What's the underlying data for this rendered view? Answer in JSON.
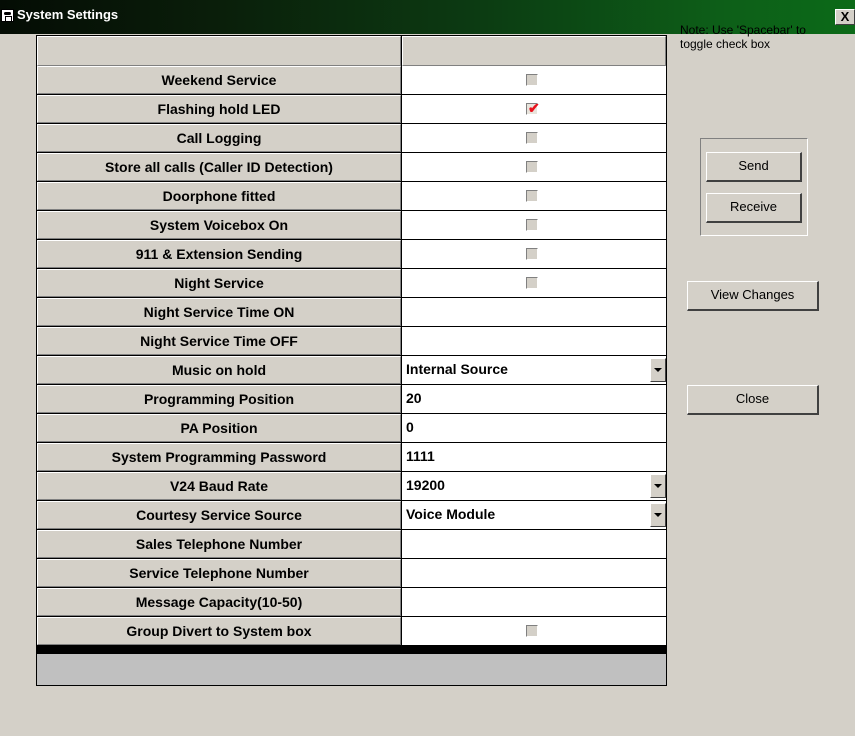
{
  "window": {
    "title": "System Settings",
    "close_glyph": "X"
  },
  "note": "Note: Use 'Spacebar' to toggle check box",
  "buttons": {
    "send": "Send",
    "receive": "Receive",
    "view_changes": "View Changes",
    "close": "Close"
  },
  "colors": {
    "check_mark": "#e8111c",
    "panel": "#d4d0c8",
    "title_start": "#040c04",
    "title_end": "#0c6a18"
  },
  "icons": {
    "app": "phone-icon",
    "check": "check-mark-icon",
    "dropdown": "chevron-down-icon"
  },
  "settings": [
    {
      "label": "Weekend Service",
      "type": "checkbox",
      "checked": false
    },
    {
      "label": "Flashing hold LED",
      "type": "checkbox",
      "checked": true
    },
    {
      "label": "Call Logging",
      "type": "checkbox",
      "checked": false
    },
    {
      "label": "Store all calls (Caller ID Detection)",
      "type": "checkbox",
      "checked": false
    },
    {
      "label": "Doorphone fitted",
      "type": "checkbox",
      "checked": false
    },
    {
      "label": "System Voicebox On",
      "type": "checkbox",
      "checked": false
    },
    {
      "label": "911 & Extension Sending",
      "type": "checkbox",
      "checked": false
    },
    {
      "label": "Night Service",
      "type": "checkbox",
      "checked": false
    },
    {
      "label": "Night Service Time ON",
      "type": "text",
      "value": ""
    },
    {
      "label": "Night Service Time OFF",
      "type": "text",
      "value": ""
    },
    {
      "label": "Music on hold",
      "type": "dropdown",
      "value": "Internal Source"
    },
    {
      "label": "Programming Position",
      "type": "text",
      "value": "20"
    },
    {
      "label": "PA Position",
      "type": "text",
      "value": "0"
    },
    {
      "label": "System Programming Password",
      "type": "text",
      "value": "1111"
    },
    {
      "label": "V24 Baud Rate",
      "type": "dropdown",
      "value": "19200"
    },
    {
      "label": "Courtesy Service Source",
      "type": "dropdown",
      "value": "Voice Module"
    },
    {
      "label": "Sales Telephone Number",
      "type": "text",
      "value": ""
    },
    {
      "label": "Service Telephone Number",
      "type": "text",
      "value": ""
    },
    {
      "label": "Message Capacity(10-50)",
      "type": "text",
      "value": ""
    },
    {
      "label": "Group Divert to System box",
      "type": "checkbox",
      "checked": false
    }
  ]
}
